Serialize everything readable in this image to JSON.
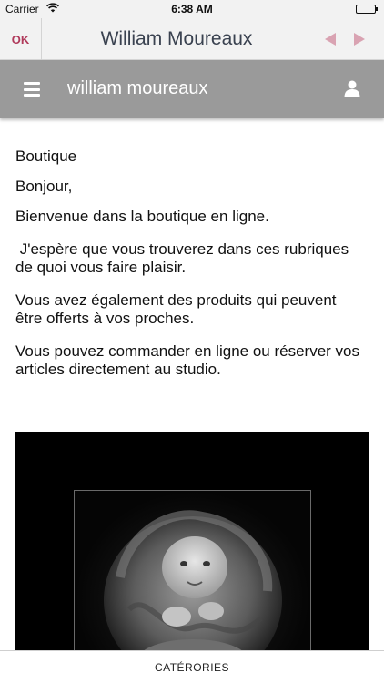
{
  "status_bar": {
    "carrier": "Carrier",
    "time": "6:38 AM",
    "wifi_icon": "wifi-icon",
    "battery_icon": "battery-icon"
  },
  "nav_bar": {
    "ok_label": "OK",
    "title": "William Moureaux",
    "back_icon": "arrow-left-icon",
    "forward_icon": "arrow-right-icon",
    "accent_color": "#b03a5b"
  },
  "app_header": {
    "title": "william moureaux",
    "menu_icon": "hamburger-menu-icon",
    "user_icon": "user-icon",
    "background_color": "#9a9a9a"
  },
  "content": {
    "heading": "Boutique",
    "greeting": "Bonjour,",
    "paragraphs": [
      "Bienvenue dans la boutique en ligne.",
      " J'espère que vous trouverez dans ces rubriques de quoi vous faire plaisir.",
      "Vous avez également des produits qui peuvent être offerts à vos proches.",
      "Vous pouvez commander en ligne ou réserver vos articles directement au studio."
    ]
  },
  "bottom_bar": {
    "label": "CATÉRORIES"
  }
}
